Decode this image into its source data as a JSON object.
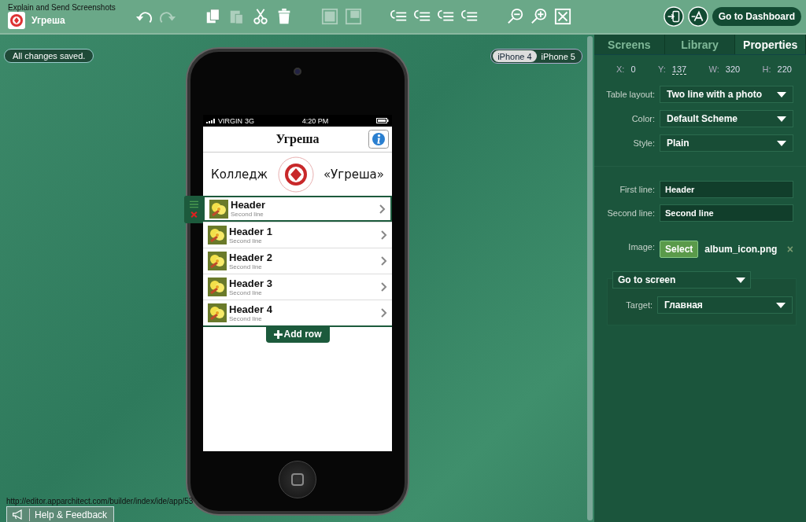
{
  "overlay_caption": "Explain and Send Screenshots",
  "app": {
    "title": "Угреша"
  },
  "toolbar": [
    {
      "kind": "undo",
      "disabled": false
    },
    {
      "kind": "redo",
      "disabled": true
    },
    {
      "kind": "copy",
      "disabled": false
    },
    {
      "kind": "paste",
      "disabled": true
    },
    {
      "kind": "cut",
      "disabled": false
    },
    {
      "kind": "delete",
      "disabled": false
    },
    {
      "kind": "front",
      "disabled": true
    },
    {
      "kind": "back",
      "disabled": true
    },
    {
      "kind": "align",
      "disabled": false
    },
    {
      "kind": "align",
      "disabled": false
    },
    {
      "kind": "align",
      "disabled": false
    },
    {
      "kind": "align",
      "disabled": false
    },
    {
      "kind": "zoomout",
      "disabled": false
    },
    {
      "kind": "zoomin",
      "disabled": false
    },
    {
      "kind": "fit",
      "disabled": false
    }
  ],
  "dashboard_button": "Go to Dashboard",
  "save_status": "All changes saved.",
  "devices": [
    {
      "label": "iPhone 4",
      "selected": true
    },
    {
      "label": "iPhone 5",
      "selected": false
    }
  ],
  "phone": {
    "carrier": "VIRGIN",
    "network": "3G",
    "time": "4:20 PM",
    "nav_title": "Угреша",
    "banner_left": "Колледж",
    "banner_right": "«Угреша»",
    "rows": [
      {
        "header": "Header",
        "second": "Second line",
        "selected": true
      },
      {
        "header": "Header 1",
        "second": "Second line",
        "selected": false
      },
      {
        "header": "Header 2",
        "second": "Second line",
        "selected": false
      },
      {
        "header": "Header 3",
        "second": "Second line",
        "selected": false
      },
      {
        "header": "Header 4",
        "second": "Second line",
        "selected": false
      }
    ],
    "add_row": "Add row"
  },
  "panel": {
    "tabs": [
      {
        "label": "Screens",
        "selected": false
      },
      {
        "label": "Library",
        "selected": false
      },
      {
        "label": "Properties",
        "selected": true
      }
    ],
    "geometry": [
      {
        "label": "X:",
        "value": "0"
      },
      {
        "label": "Y:",
        "value": "137"
      },
      {
        "label": "W:",
        "value": "320"
      },
      {
        "label": "H:",
        "value": "220"
      }
    ],
    "selects": [
      {
        "label": "Table layout:",
        "value": "Two line with a photo"
      },
      {
        "label": "Color:",
        "value": "Default Scheme"
      },
      {
        "label": "Style:",
        "value": "Plain"
      }
    ],
    "fields": [
      {
        "label": "First line:",
        "value": "Header"
      },
      {
        "label": "Second line:",
        "value": "Second line"
      }
    ],
    "image": {
      "label": "Image:",
      "button": "Select",
      "file": "album_icon.png",
      "remove": "×"
    },
    "action": {
      "value": "Go to screen",
      "target_label": "Target:",
      "target": "Главная"
    }
  },
  "url": "http://editor.apparchitect.com/builder/index/ide/app/53",
  "help_button": "Help & Feedback"
}
